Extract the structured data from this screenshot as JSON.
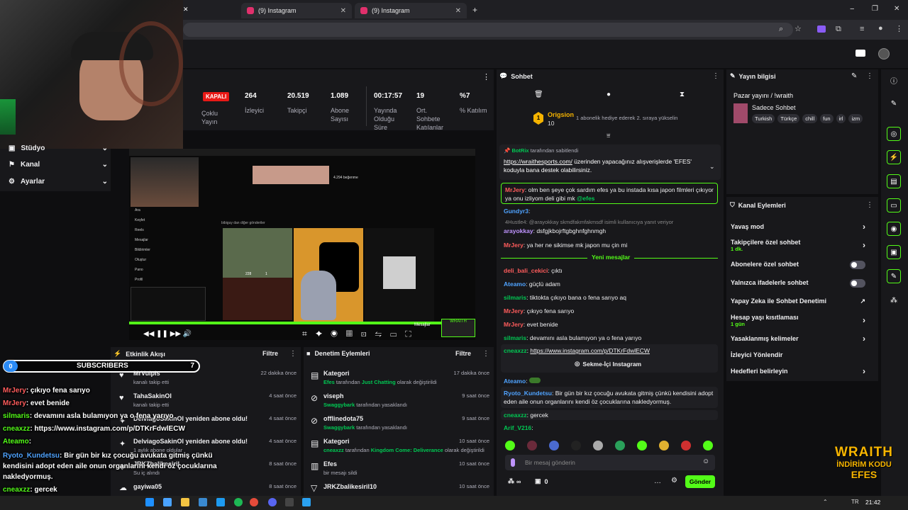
{
  "browser": {
    "tabs": [
      {
        "label": "(9) Instagram"
      },
      {
        "label": "(9) Instagram"
      }
    ],
    "window_controls": [
      "−",
      "❐",
      "✕"
    ]
  },
  "stream_stats": {
    "status": "KAPALI",
    "items": [
      {
        "value": "",
        "label": "Çoklu Yayın"
      },
      {
        "value": "264",
        "label": "İzleyici"
      },
      {
        "value": "20.519",
        "label": "Takipçi"
      },
      {
        "value": "1.089",
        "label": "Abone Sayısı"
      },
      {
        "value": "00:17:57",
        "label": "Yayında Olduğu Süre"
      },
      {
        "value": "19",
        "label": "Ort. Sohbete Katılanlar"
      },
      {
        "value": "%7",
        "label": "% Katılım"
      }
    ]
  },
  "left_nav": {
    "items": [
      {
        "label": "Stüdyo"
      },
      {
        "label": "Kanal"
      },
      {
        "label": "Ayarlar"
      }
    ]
  },
  "embedded_screen": {
    "menu": [
      "Ara",
      "Keşfet",
      "Reels",
      "Mesajlar",
      "Bildirimler",
      "Oluştur",
      "Pano",
      "Profil"
    ],
    "likes": "4.294 beğenme",
    "post_likes": "228",
    "post_comments": "1",
    "msg_label": "Mesajlar",
    "section": "bibiguy dan diğer gönderiler"
  },
  "activity_feed": {
    "title": "Etkinlik Akışı",
    "filter": "Filtre",
    "items": [
      {
        "title": "MrVulpis",
        "sub": "kanalı takip etti",
        "time": "22 dakika önce"
      },
      {
        "title": "TahaSakinOl",
        "sub": "kanalı takip etti",
        "time": "4 saat önce"
      },
      {
        "title": "DelviagoSakinOl yeniden abone oldu!",
        "sub": "",
        "time": "4 saat önce"
      },
      {
        "title": "DelviagoSakinOl yeniden abone oldu!",
        "sub": "1 aylık abone oldular",
        "time": "4 saat önce"
      },
      {
        "title": "JRKZbalikesiril",
        "sub": "Su iç alındı",
        "time": "8 saat önce"
      },
      {
        "title": "gayiwa05",
        "sub": "",
        "time": "8 saat önce"
      }
    ]
  },
  "mod_actions": {
    "title": "Denetim Eylemleri",
    "filter": "Filtre",
    "items": [
      {
        "title": "Kategori",
        "sub_name": "Efes",
        "sub_text": " tarafından ",
        "sub_value": "Just Chatting",
        "sub_tail": " olarak değiştirildi",
        "time": "17 dakika önce"
      },
      {
        "title": "viseph",
        "sub_name": "Swaggybark",
        "sub_text": " tarafından yasaklandı",
        "sub_value": "",
        "sub_tail": "",
        "time": "9 saat önce"
      },
      {
        "title": "offlinedota75",
        "sub_name": "Swaggybark",
        "sub_text": " tarafından yasaklandı",
        "sub_value": "",
        "sub_tail": "",
        "time": "9 saat önce"
      },
      {
        "title": "Kategori",
        "sub_name": "cneaxzz",
        "sub_text": " tarafından ",
        "sub_value": "Kingdom Come: Deliverance",
        "sub_tail": " olarak değiştirildi",
        "time": "10 saat önce"
      },
      {
        "title": "Efes",
        "sub_name": "",
        "sub_text": "bir mesajı sildi",
        "sub_value": "",
        "sub_tail": "",
        "time": "10 saat önce"
      },
      {
        "title": "JRKZbalikesiril10",
        "sub_name": "",
        "sub_text": "",
        "sub_value": "",
        "sub_tail": "",
        "time": "10 saat önce"
      }
    ]
  },
  "chat": {
    "title": "Sohbet",
    "top_gifter": {
      "name": "Origsion",
      "count": "10",
      "text": "1 abonelik hediye ederek 2. sıraya yükselin"
    },
    "pinned": {
      "by": "BotRix",
      "by_suffix": " tarafından sabitlendi",
      "link": "https://wraithesports.com/",
      "text": " üzerinden yapacağınız alışverişlerde 'EFES' koduyla bana destek olabilirsiniz."
    },
    "messages": [
      {
        "user": "MrJery",
        "text": "olm ben şeye çok sardım efes ya bu instada kısa japon filmleri çıkıyor ya onu izliyom deli gibi mk ",
        "mention": "@efes"
      },
      {
        "user": "Gundyr3",
        "text": ""
      },
      {
        "user": "",
        "text": "4Hustle4: @arayokkay skmdfakmfakmsdf isimli kullanıcıya yanıt veriyor"
      },
      {
        "user": "arayokkay",
        "text": "dsfgjkbojrftgbghnfghnmgh"
      },
      {
        "user": "MrJery",
        "text": "ya her ne sikimse mk japon mu çin mi"
      }
    ],
    "new_label": "Yeni mesajlar",
    "new_messages": [
      {
        "user": "deli_bali_cekici",
        "text": "çıktı"
      },
      {
        "user": "Ateamo",
        "text": "güçlü adam"
      },
      {
        "user": "silmaris",
        "text": "tiktokta çıkıyo bana o fena sarıyo aq"
      },
      {
        "user": "MrJery",
        "text": "çıkıyo fena sarıyo"
      },
      {
        "user": "MrJery",
        "text": "evet benide"
      },
      {
        "user": "silmaris",
        "text": "devamını asla bulamıyon ya o fena yarıyo"
      }
    ],
    "link_msg": {
      "user": "cneaxzz",
      "link": "https://www.instagram.com/p/DTKrFdwlECW",
      "button": "Sekme-İçi Instagram"
    },
    "after": [
      {
        "user": "Ateamo",
        "text": ""
      },
      {
        "user": "Ryoto_Kundetsu",
        "text": "Bir gün bir kız çocuğu avukata gitmiş çünkü kendisini adopt eden aile onun organlarını kendi öz çocuklarına nakledyormuş."
      },
      {
        "user": "cneaxzz",
        "text": "gercek"
      },
      {
        "user": "Arif_V216",
        "text": ""
      }
    ],
    "input_placeholder": "Bir mesaj gönderin",
    "points": "∞",
    "gift_count": "0",
    "send_label": "Gönder"
  },
  "stream_info": {
    "title": "Yayın bilgisi",
    "stream_title": "Pazar yayını / !wraith",
    "category": "Sadece Sohbet",
    "tags": [
      "Turkish",
      "Türkçe",
      "chill",
      "fun",
      "irl",
      "izm"
    ]
  },
  "channel_actions": {
    "title": "Kanal Eylemleri",
    "items": [
      {
        "label": "Yavaş mod",
        "sub": "",
        "control": "chevron"
      },
      {
        "label": "Takipçilere özel sohbet",
        "sub": "1 dk.",
        "control": "chevron"
      },
      {
        "label": "Abonelere özel sohbet",
        "sub": "",
        "control": "toggle"
      },
      {
        "label": "Yalnızca ifadelerle sohbet",
        "sub": "",
        "control": "toggle"
      },
      {
        "label": "Yapay Zeka ile Sohbet Denetimi",
        "sub": "",
        "control": "external"
      },
      {
        "label": "Hesap yaşı kısıtlaması",
        "sub": "1 gün",
        "control": "chevron"
      },
      {
        "label": "Yasaklanmış kelimeler",
        "sub": "",
        "control": "chevron"
      },
      {
        "label": "İzleyici Yönlendir",
        "sub": "",
        "control": ""
      },
      {
        "label": "Hedefleri belirleyin",
        "sub": "",
        "control": "chevron"
      }
    ]
  },
  "overlay": {
    "subs_label": "SUBSCRIBERS",
    "subs_left": "0",
    "subs_right": "7",
    "chat": [
      {
        "user": "MrJery",
        "text": ": çıkıyo fena sarıyo"
      },
      {
        "user": "MrJery",
        "text": ": evet benide"
      },
      {
        "user": "silmaris",
        "text": ": devamını asla bulamıyon ya o fena yarıyo"
      },
      {
        "user": "cneaxzz",
        "text": ": https://www.instagram.com/p/DTKrFdwlECW"
      },
      {
        "user": "Ryoto_Kundetsu",
        "text": ": Bir gün bir kız çocuğu avukata gitmiş çünkü kendisini adopt eden aile onun organlarını kendi öz çocuklarına nakledyormuş."
      },
      {
        "user": "Ateamo",
        "text": ":"
      },
      {
        "user": "cneaxzz",
        "text": ": gercek"
      }
    ],
    "sponsor_line1": "WRAITH",
    "sponsor_line2": "İNDİRİM KODU",
    "sponsor_line3": "EFES"
  },
  "taskbar": {
    "time": "21:42",
    "lang": "TR"
  },
  "colors": {
    "accent": "#53fc18",
    "purple": "#bf94ff",
    "live_red": "#e91916"
  }
}
